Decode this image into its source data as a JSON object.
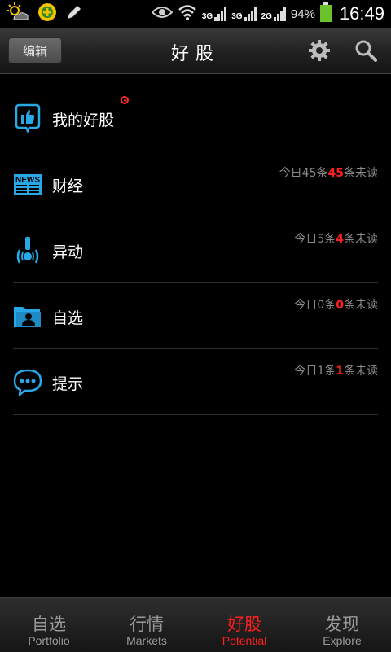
{
  "status_bar": {
    "battery_percent": "94%",
    "time": "16:49",
    "net1": "3G",
    "net2": "3G",
    "net3": "2G",
    "icons": [
      "weather-icon",
      "app-icon",
      "pen-icon",
      "eye-icon",
      "wifi-icon",
      "signal-icon",
      "battery-icon"
    ]
  },
  "header": {
    "edit_label": "编辑",
    "title": "好股",
    "icons": [
      "gear-icon",
      "search-icon"
    ]
  },
  "list": [
    {
      "label": "我的好股",
      "icon": "thumbs-up-icon",
      "has_badge": true
    },
    {
      "label": "财经",
      "icon": "news-icon",
      "info_pre": "今日45条",
      "info_count": "45",
      "info_post": "条未读"
    },
    {
      "label": "异动",
      "icon": "alert-signal-icon",
      "info_pre": "今日5条",
      "info_count": "4",
      "info_post": "条未读"
    },
    {
      "label": "自选",
      "icon": "folder-user-icon",
      "info_pre": "今日0条",
      "info_count": "0",
      "info_post": "条未读"
    },
    {
      "label": "提示",
      "icon": "chat-bubble-icon",
      "info_pre": "今日1条",
      "info_count": "1",
      "info_post": "条未读"
    }
  ],
  "tabs": [
    {
      "cn": "自选",
      "en": "Portfolio",
      "active": false
    },
    {
      "cn": "行情",
      "en": "Markets",
      "active": false
    },
    {
      "cn": "好股",
      "en": "Potential",
      "active": true
    },
    {
      "cn": "发现",
      "en": "Explore",
      "active": false
    }
  ],
  "colors": {
    "accent": "#ff1e1e",
    "icon_blue": "#29a8e8",
    "background": "#000000"
  }
}
